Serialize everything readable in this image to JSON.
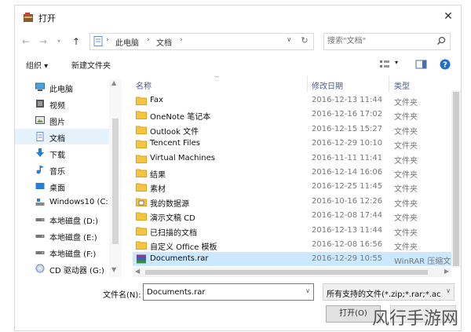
{
  "window": {
    "title": "打开"
  },
  "nav": {
    "crumbs": [
      "此电脑",
      "文档"
    ],
    "search_placeholder": "搜索\"文档\""
  },
  "toolbar": {
    "organize": "组织 ▾",
    "new_folder": "新建文件夹"
  },
  "sidebar": {
    "items": [
      {
        "label": "此电脑",
        "icon": "computer-icon"
      },
      {
        "label": "视频",
        "icon": "video-icon"
      },
      {
        "label": "图片",
        "icon": "picture-icon"
      },
      {
        "label": "文档",
        "icon": "document-icon",
        "selected": true
      },
      {
        "label": "下载",
        "icon": "download-icon"
      },
      {
        "label": "音乐",
        "icon": "music-icon"
      },
      {
        "label": "桌面",
        "icon": "desktop-icon"
      },
      {
        "label": "Windows10 (C:",
        "icon": "drive-icon"
      },
      {
        "label": "本地磁盘 (D:)",
        "icon": "drive-icon"
      },
      {
        "label": "本地磁盘 (E:)",
        "icon": "drive-icon"
      },
      {
        "label": "本地磁盘 (F:)",
        "icon": "drive-icon"
      },
      {
        "label": "CD 驱动器 (G:)",
        "icon": "cd-drive-icon"
      }
    ]
  },
  "columns": {
    "name": "名称",
    "date": "修改日期",
    "type": "类型"
  },
  "files": [
    {
      "name": "Fax",
      "date": "2016-12-13 11:44",
      "type": "文件夹",
      "icon": "folder-icon"
    },
    {
      "name": "OneNote 笔记本",
      "date": "2016-12-16 17:02",
      "type": "文件夹",
      "icon": "folder-icon"
    },
    {
      "name": "Outlook 文件",
      "date": "2016-12-15 15:27",
      "type": "文件夹",
      "icon": "folder-icon"
    },
    {
      "name": "Tencent Files",
      "date": "2016-12-29 10:10",
      "type": "文件夹",
      "icon": "folder-icon"
    },
    {
      "name": "Virtual Machines",
      "date": "2016-11-11 11:41",
      "type": "文件夹",
      "icon": "folder-icon"
    },
    {
      "name": "结果",
      "date": "2016-12-14 16:06",
      "type": "文件夹",
      "icon": "folder-icon"
    },
    {
      "name": "素材",
      "date": "2016-12-25 11:45",
      "type": "文件夹",
      "icon": "folder-icon"
    },
    {
      "name": "我的数据源",
      "date": "2016-10-16 12:26",
      "type": "文件夹",
      "icon": "datasource-folder-icon"
    },
    {
      "name": "演示文稿 CD",
      "date": "2016-12-08 17:44",
      "type": "文件夹",
      "icon": "folder-icon"
    },
    {
      "name": "已扫描的文档",
      "date": "2016-12-13 11:44",
      "type": "文件夹",
      "icon": "folder-icon"
    },
    {
      "name": "自定义 Office 模板",
      "date": "2016-12-08 16:56",
      "type": "文件夹",
      "icon": "folder-icon"
    },
    {
      "name": "Documents.rar",
      "date": "2016-12-29 10:55",
      "type": "WinRAR 压缩文件",
      "icon": "rar-file-icon",
      "selected": true
    }
  ],
  "footer": {
    "filename_label": "文件名(N):",
    "filename_value": "Documents.rar",
    "filter_value": "所有支持的文件(*.zip;*.rar;*.ac",
    "open_label": "打开(O)"
  },
  "watermark": "风行手游网"
}
